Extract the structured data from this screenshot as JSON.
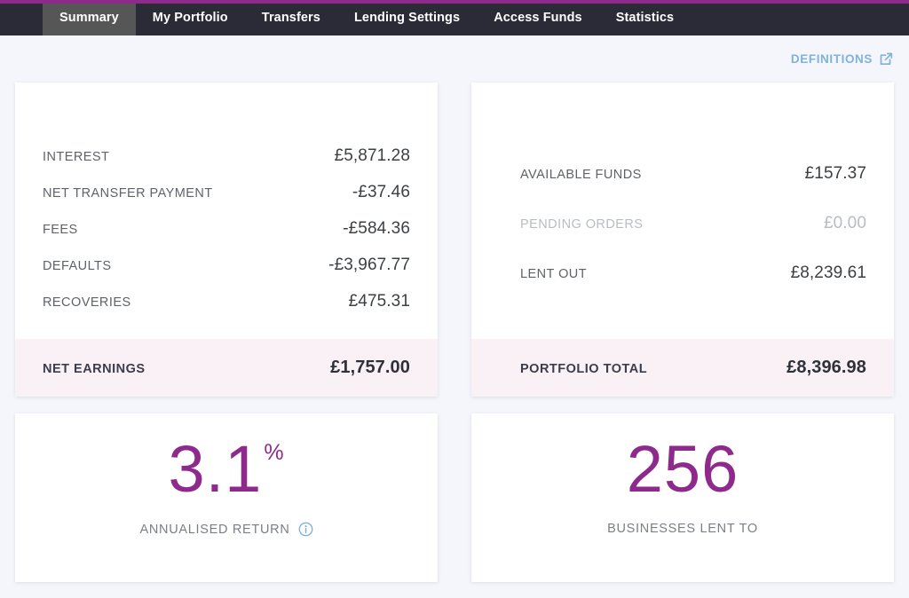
{
  "nav": {
    "tabs": [
      {
        "label": "Summary",
        "active": true
      },
      {
        "label": "My Portfolio",
        "active": false
      },
      {
        "label": "Transfers",
        "active": false
      },
      {
        "label": "Lending Settings",
        "active": false
      },
      {
        "label": "Access Funds",
        "active": false
      },
      {
        "label": "Statistics",
        "active": false
      }
    ]
  },
  "definitions": {
    "label": "DEFINITIONS",
    "icon": "external-link-icon"
  },
  "earnings_card": {
    "rows": [
      {
        "label": "INTEREST",
        "value": "£5,871.28"
      },
      {
        "label": "NET TRANSFER PAYMENT",
        "value": "-£37.46"
      },
      {
        "label": "FEES",
        "value": "-£584.36"
      },
      {
        "label": "DEFAULTS",
        "value": "-£3,967.77"
      },
      {
        "label": "RECOVERIES",
        "value": "£475.31"
      }
    ],
    "footer": {
      "label": "NET EARNINGS",
      "value": "£1,757.00"
    }
  },
  "portfolio_card": {
    "rows": [
      {
        "label": "AVAILABLE FUNDS",
        "value": "£157.37",
        "muted": false
      },
      {
        "label": "PENDING ORDERS",
        "value": "£0.00",
        "muted": true
      },
      {
        "label": "LENT OUT",
        "value": "£8,239.61",
        "muted": false
      }
    ],
    "footer": {
      "label": "PORTFOLIO TOTAL",
      "value": "£8,396.98"
    }
  },
  "metrics": {
    "annualised_return": {
      "number": "3.1",
      "suffix": "%",
      "label": "ANNUALISED RETURN",
      "info_icon": "info-icon"
    },
    "businesses": {
      "number": "256",
      "suffix": "",
      "label": "BUSINESSES LENT TO"
    }
  },
  "colors": {
    "accent_purple": "#8e2a8b",
    "nav_background": "#2b2b38",
    "active_tab": "#565656",
    "footer_background": "#faf1f7",
    "link_blue": "#7fb2dd",
    "page_background": "#f4f6fb"
  }
}
